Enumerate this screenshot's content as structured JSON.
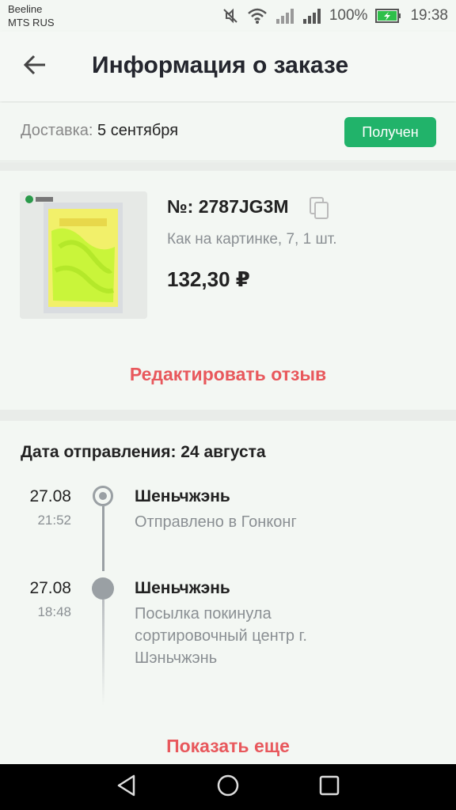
{
  "status_bar": {
    "carrier_1": "Beeline",
    "carrier_2": "MTS RUS",
    "battery": "100%",
    "time": "19:38"
  },
  "header": {
    "title": "Информация о заказе"
  },
  "delivery": {
    "label": "Доставка:",
    "date": "5 сентября",
    "status": "Получен"
  },
  "product": {
    "order_label": "№: 2787JG3M",
    "variant": "Как на картинке, 7, 1 шт.",
    "price": "132,30 ₽",
    "edit_review": "Редактировать отзыв"
  },
  "tracking": {
    "ship_date": "Дата отправления: 24 августа",
    "events": [
      {
        "date": "27.08",
        "time": "21:52",
        "title": "Шеньчжэнь",
        "desc": "Отправлено в Гонконг"
      },
      {
        "date": "27.08",
        "time": "18:48",
        "title": "Шеньчжэнь",
        "desc": "Посылка покинула сортировочный центр г. Шэньчжэнь"
      }
    ],
    "show_more": "Показать еще"
  },
  "colors": {
    "accent_green": "#21b36a",
    "link_red": "#e8585c",
    "background": "#f3f7f3"
  }
}
